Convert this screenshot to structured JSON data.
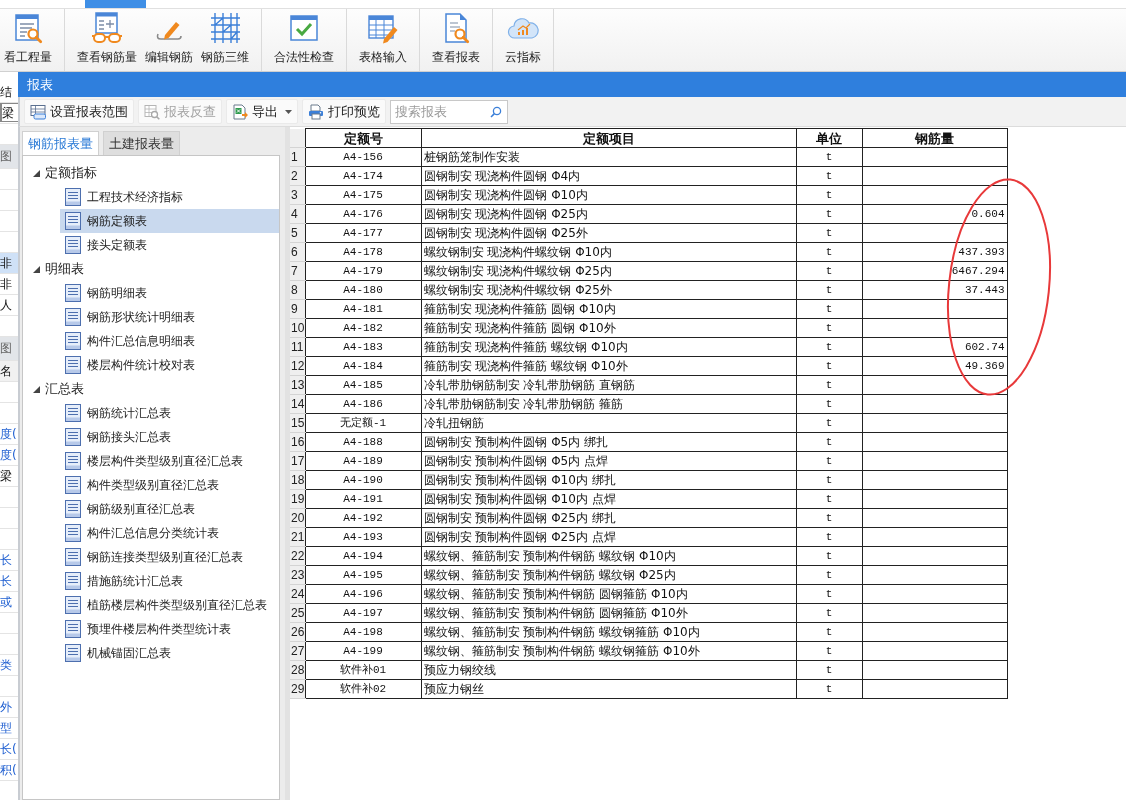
{
  "menu_tabs": [
    {
      "selected": false
    },
    {
      "selected": false
    },
    {
      "selected": true
    },
    {
      "selected": false
    }
  ],
  "ribbon": {
    "groups": [
      {
        "buttons": [
          {
            "label": "看工程量"
          }
        ]
      },
      {
        "buttons": [
          {
            "label": "查看钢筋量"
          },
          {
            "label": "编辑钢筋"
          },
          {
            "label": "钢筋三维"
          }
        ]
      },
      {
        "buttons": [
          {
            "label": "合法性检查"
          }
        ]
      },
      {
        "buttons": [
          {
            "label": "表格输入"
          }
        ]
      },
      {
        "buttons": [
          {
            "label": "查看报表"
          }
        ]
      },
      {
        "buttons": [
          {
            "label": "云指标"
          }
        ]
      }
    ]
  },
  "background_panel": {
    "rows": [
      {
        "kind": "text",
        "text": "结",
        "selected": false
      },
      {
        "kind": "field",
        "text": "梁"
      },
      {
        "kind": "blank"
      },
      {
        "kind": "tab",
        "text": "图"
      },
      {
        "kind": "blank"
      },
      {
        "kind": "blank"
      },
      {
        "kind": "blank"
      },
      {
        "kind": "blank"
      },
      {
        "kind": "text",
        "text": "非",
        "selected": true
      },
      {
        "kind": "text",
        "text": "非",
        "selected": false
      },
      {
        "kind": "text",
        "text": "人",
        "selected": false
      },
      {
        "kind": "blank"
      },
      {
        "kind": "tab",
        "text": "图"
      },
      {
        "kind": "header",
        "text": "名"
      },
      {
        "kind": "blank"
      },
      {
        "kind": "blank"
      },
      {
        "kind": "link",
        "text": "度(",
        "selected": false
      },
      {
        "kind": "link",
        "text": "度(",
        "selected": false
      },
      {
        "kind": "text",
        "text": "梁",
        "selected": false
      },
      {
        "kind": "blank"
      },
      {
        "kind": "blank"
      },
      {
        "kind": "blank"
      },
      {
        "kind": "link",
        "text": "长",
        "selected": false
      },
      {
        "kind": "link",
        "text": "长",
        "selected": false
      },
      {
        "kind": "link",
        "text": "或",
        "selected": false
      },
      {
        "kind": "blank"
      },
      {
        "kind": "blank"
      },
      {
        "kind": "link",
        "text": "类",
        "selected": false
      },
      {
        "kind": "blank"
      },
      {
        "kind": "link",
        "text": "外",
        "selected": false
      },
      {
        "kind": "link",
        "text": "型",
        "selected": false
      },
      {
        "kind": "link",
        "text": "长(",
        "selected": false
      },
      {
        "kind": "link",
        "text": "积(",
        "selected": false
      }
    ]
  },
  "dialog": {
    "title": "报表",
    "toolbar": [
      {
        "kind": "button",
        "label": "设置报表范围",
        "disabled": false
      },
      {
        "kind": "button",
        "label": "报表反查",
        "disabled": true
      },
      {
        "kind": "dropdown",
        "label": "导出",
        "disabled": false
      },
      {
        "kind": "button",
        "label": "打印预览",
        "disabled": false
      }
    ],
    "search": {
      "placeholder": "搜索报表"
    },
    "tabs": [
      {
        "label": "钢筋报表量",
        "selected": true
      },
      {
        "label": "土建报表量",
        "selected": false
      }
    ],
    "tree": [
      {
        "label": "定额指标",
        "expanded": true,
        "children": [
          {
            "label": "工程技术经济指标",
            "selected": false
          },
          {
            "label": "钢筋定额表",
            "selected": true
          },
          {
            "label": "接头定额表",
            "selected": false
          }
        ]
      },
      {
        "label": "明细表",
        "expanded": true,
        "children": [
          {
            "label": "钢筋明细表",
            "selected": false
          },
          {
            "label": "钢筋形状统计明细表",
            "selected": false
          },
          {
            "label": "构件汇总信息明细表",
            "selected": false
          },
          {
            "label": "楼层构件统计校对表",
            "selected": false
          }
        ]
      },
      {
        "label": "汇总表",
        "expanded": true,
        "children": [
          {
            "label": "钢筋统计汇总表",
            "selected": false
          },
          {
            "label": "钢筋接头汇总表",
            "selected": false
          },
          {
            "label": "楼层构件类型级别直径汇总表",
            "selected": false
          },
          {
            "label": "构件类型级别直径汇总表",
            "selected": false
          },
          {
            "label": "钢筋级别直径汇总表",
            "selected": false
          },
          {
            "label": "构件汇总信息分类统计表",
            "selected": false
          },
          {
            "label": "钢筋连接类型级别直径汇总表",
            "selected": false
          },
          {
            "label": "措施筋统计汇总表",
            "selected": false
          },
          {
            "label": "植筋楼层构件类型级别直径汇总表",
            "selected": false
          },
          {
            "label": "预埋件楼层构件类型统计表",
            "selected": false
          },
          {
            "label": "机械锚固汇总表",
            "selected": false
          }
        ]
      }
    ],
    "table": {
      "columns": [
        "定额号",
        "定额项目",
        "单位",
        "钢筋量"
      ],
      "rows": [
        {
          "number": "1",
          "code": "A4-156",
          "item": "桩钢筋笼制作安装",
          "unit": "t"
        },
        {
          "number": "2",
          "code": "A4-174",
          "item": "圆钢制安 现浇构件圆钢 Φ4内",
          "unit": "t"
        },
        {
          "number": "3",
          "code": "A4-175",
          "item": "圆钢制安 现浇构件圆钢 Φ10内",
          "unit": "t"
        },
        {
          "number": "4",
          "code": "A4-176",
          "item": "圆钢制安 现浇构件圆钢 Φ25内",
          "unit": "t",
          "amount": "0.604"
        },
        {
          "number": "5",
          "code": "A4-177",
          "item": "圆钢制安 现浇构件圆钢 Φ25外",
          "unit": "t"
        },
        {
          "number": "6",
          "code": "A4-178",
          "item": "螺纹钢制安 现浇构件螺纹钢 Φ10内",
          "unit": "t",
          "amount": "437.393"
        },
        {
          "number": "7",
          "code": "A4-179",
          "item": "螺纹钢制安 现浇构件螺纹钢 Φ25内",
          "unit": "t",
          "amount": "6467.294"
        },
        {
          "number": "8",
          "code": "A4-180",
          "item": "螺纹钢制安 现浇构件螺纹钢 Φ25外",
          "unit": "t",
          "amount": "37.443"
        },
        {
          "number": "9",
          "code": "A4-181",
          "item": "箍筋制安 现浇构件箍筋 圆钢 Φ10内",
          "unit": "t"
        },
        {
          "number": "10",
          "code": "A4-182",
          "item": "箍筋制安 现浇构件箍筋 圆钢 Φ10外",
          "unit": "t"
        },
        {
          "number": "11",
          "code": "A4-183",
          "item": "箍筋制安 现浇构件箍筋 螺纹钢 Φ10内",
          "unit": "t",
          "amount": "602.74"
        },
        {
          "number": "12",
          "code": "A4-184",
          "item": "箍筋制安 现浇构件箍筋 螺纹钢 Φ10外",
          "unit": "t",
          "amount": "49.369"
        },
        {
          "number": "13",
          "code": "A4-185",
          "item": "冷轧带肋钢筋制安 冷轧带肋钢筋 直钢筋",
          "unit": "t"
        },
        {
          "number": "14",
          "code": "A4-186",
          "item": "冷轧带肋钢筋制安 冷轧带肋钢筋 箍筋",
          "unit": "t"
        },
        {
          "number": "15",
          "code": "无定额-1",
          "item": "冷轧扭钢筋",
          "unit": "t"
        },
        {
          "number": "16",
          "code": "A4-188",
          "item": "圆钢制安 预制构件圆钢 Φ5内 绑扎",
          "unit": "t"
        },
        {
          "number": "17",
          "code": "A4-189",
          "item": "圆钢制安 预制构件圆钢 Φ5内 点焊",
          "unit": "t"
        },
        {
          "number": "18",
          "code": "A4-190",
          "item": "圆钢制安 预制构件圆钢 Φ10内 绑扎",
          "unit": "t"
        },
        {
          "number": "19",
          "code": "A4-191",
          "item": "圆钢制安 预制构件圆钢 Φ10内 点焊",
          "unit": "t"
        },
        {
          "number": "20",
          "code": "A4-192",
          "item": "圆钢制安 预制构件圆钢 Φ25内 绑扎",
          "unit": "t"
        },
        {
          "number": "21",
          "code": "A4-193",
          "item": "圆钢制安 预制构件圆钢 Φ25内 点焊",
          "unit": "t"
        },
        {
          "number": "22",
          "code": "A4-194",
          "item": "螺纹钢、箍筋制安 预制构件钢筋 螺纹钢 Φ10内",
          "unit": "t"
        },
        {
          "number": "23",
          "code": "A4-195",
          "item": "螺纹钢、箍筋制安 预制构件钢筋 螺纹钢 Φ25内",
          "unit": "t"
        },
        {
          "number": "24",
          "code": "A4-196",
          "item": "螺纹钢、箍筋制安 预制构件钢筋 圆钢箍筋 Φ10内",
          "unit": "t"
        },
        {
          "number": "25",
          "code": "A4-197",
          "item": "螺纹钢、箍筋制安 预制构件钢筋 圆钢箍筋 Φ10外",
          "unit": "t"
        },
        {
          "number": "26",
          "code": "A4-198",
          "item": "螺纹钢、箍筋制安 预制构件钢筋 螺纹钢箍筋 Φ10内",
          "unit": "t"
        },
        {
          "number": "27",
          "code": "A4-199",
          "item": "螺纹钢、箍筋制安 预制构件钢筋 螺纹钢箍筋 Φ10外",
          "unit": "t"
        },
        {
          "number": "28",
          "code": "软件补01",
          "item": "预应力钢绞线",
          "unit": "t"
        },
        {
          "number": "29",
          "code": "软件补02",
          "item": "预应力钢丝",
          "unit": "t"
        }
      ]
    },
    "annotations": [
      {
        "kind": "ellipse"
      }
    ]
  }
}
